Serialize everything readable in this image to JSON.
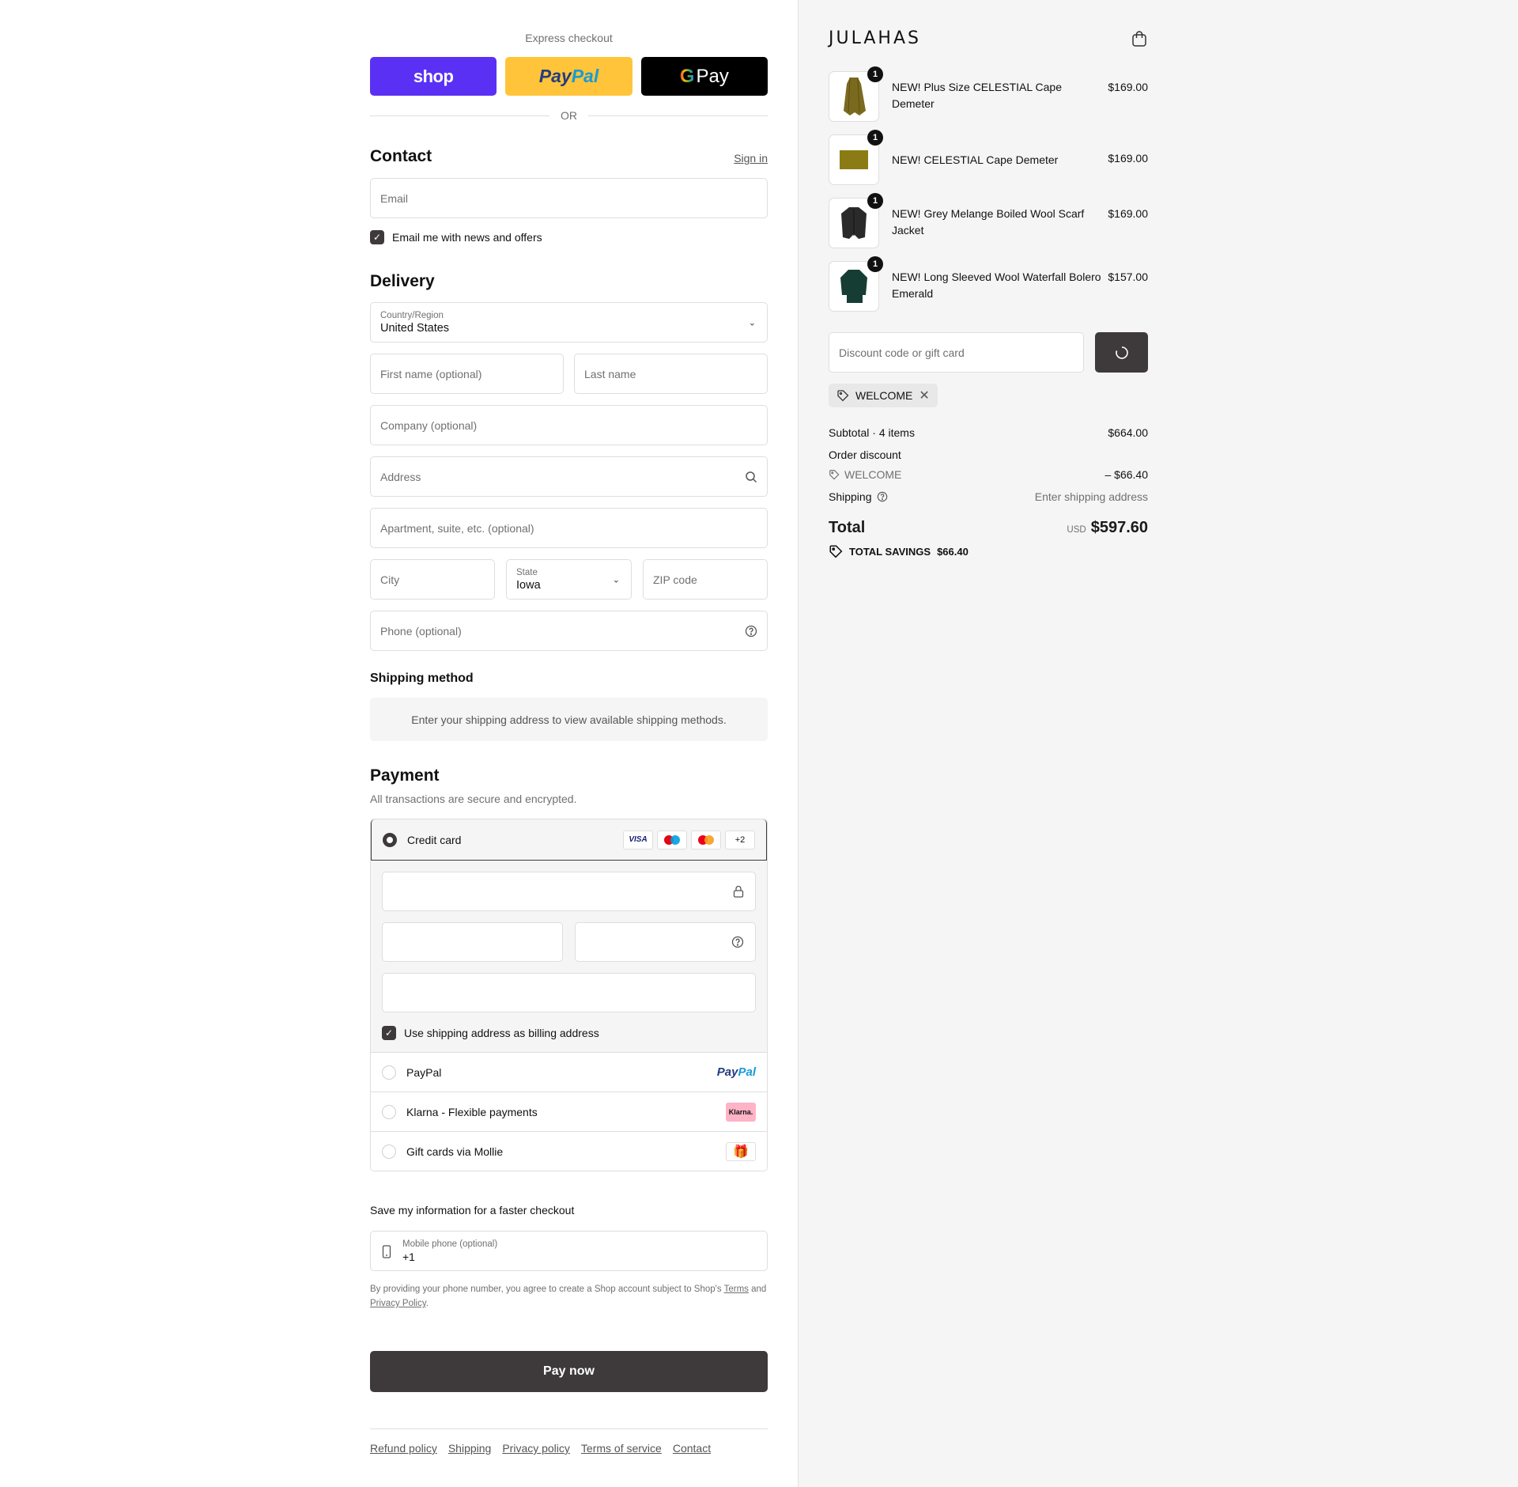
{
  "express": {
    "label": "Express checkout",
    "shop": "shop",
    "paypal_a": "Pay",
    "paypal_b": "Pal",
    "gpay_g": "G",
    "gpay": "Pay",
    "or": "OR"
  },
  "contact": {
    "title": "Contact",
    "signin": "Sign in",
    "email_placeholder": "Email",
    "news_label": "Email me with news and offers"
  },
  "delivery": {
    "title": "Delivery",
    "country_label": "Country/Region",
    "country_value": "United States",
    "first_name": "First name (optional)",
    "last_name": "Last name",
    "company": "Company (optional)",
    "address": "Address",
    "apartment": "Apartment, suite, etc. (optional)",
    "city": "City",
    "state_label": "State",
    "state_value": "Iowa",
    "zip": "ZIP code",
    "phone": "Phone (optional)"
  },
  "shipping_method": {
    "title": "Shipping method",
    "message": "Enter your shipping address to view available shipping methods."
  },
  "payment": {
    "title": "Payment",
    "subtitle": "All transactions are secure and encrypted.",
    "credit_card": "Credit card",
    "cards": [
      "VISA",
      "",
      "",
      "+2"
    ],
    "billing_label": "Use shipping address as billing address",
    "paypal": "PayPal",
    "paypal_logo_a": "Pay",
    "paypal_logo_b": "Pal",
    "klarna": "Klarna - Flexible payments",
    "klarna_logo": "Klarna.",
    "gift": "Gift cards via Mollie"
  },
  "save_info": {
    "title": "Save my information for a faster checkout",
    "mobile_label": "Mobile phone (optional)",
    "mobile_value": "+1",
    "legal_1": "By providing your phone number, you agree to create a Shop account subject to Shop's",
    "terms": "Terms",
    "legal_2": "and",
    "privacy": "Privacy Policy",
    "legal_3": "."
  },
  "pay_now": "Pay now",
  "footer": [
    "Refund policy",
    "Shipping",
    "Privacy policy",
    "Terms of service",
    "Contact"
  ],
  "summary": {
    "logo": "JULAHAS",
    "items": [
      {
        "name": "NEW! Plus Size CELESTIAL Cape Demeter",
        "price": "$169.00",
        "qty": "1",
        "color": "#7a6a1f"
      },
      {
        "name": "NEW! CELESTIAL Cape Demeter",
        "price": "$169.00",
        "qty": "1",
        "color": "#8b7b14"
      },
      {
        "name": "NEW! Grey Melange Boiled Wool Scarf Jacket",
        "price": "$169.00",
        "qty": "1",
        "color": "#2a2a2a"
      },
      {
        "name": "NEW! Long Sleeved Wool Waterfall Bolero Emerald",
        "price": "$157.00",
        "qty": "1",
        "color": "#153d33"
      }
    ],
    "discount_placeholder": "Discount code or gift card",
    "code": "WELCOME",
    "subtotal_label": "Subtotal · 4 items",
    "subtotal": "$664.00",
    "order_discount": "Order discount",
    "discount_code": "WELCOME",
    "discount_amount": "– $66.40",
    "shipping_label": "Shipping",
    "shipping_value": "Enter shipping address",
    "total_label": "Total",
    "currency": "USD",
    "total": "$597.60",
    "savings_label": "TOTAL SAVINGS",
    "savings": "$66.40"
  }
}
